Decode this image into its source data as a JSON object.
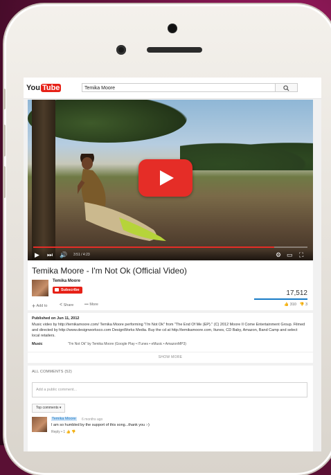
{
  "youtube": {
    "logo_you": "You",
    "logo_tube": "Tube",
    "search_query": "Temika Moore"
  },
  "player": {
    "time": "3:51 / 4:23",
    "progress_fraction": 0.88
  },
  "video": {
    "title": "Temika Moore - I'm Not Ok (Official Video)",
    "channel": "Temika Moore",
    "subscribe_label": "Subscribe",
    "views": "17,512",
    "add_to_label": "Add to",
    "share_label": "Share",
    "more_label": "More",
    "likes": "310",
    "dislikes": "3"
  },
  "description": {
    "published": "Published on Jun 11, 2012",
    "text": "Music video by http://temikamoore.com/ Temika Moore performing \"I'm Not Ok\" from \"The End Of Me (EP).\" (C) 2012 Moore II Come Entertainment Group. Filmed and directed by http://www.designworksco.com DesignWorks Media. Buy the cd at http://temikamoore.com, Itunes, CD Baby, Amazon, Band Camp and select local retailers.",
    "music_label": "Music",
    "music_value": "\"I'm Not Ok\" by Temika Moore (Google Play • iTunes • eMusic • AmazonMP3)",
    "show_more": "SHOW MORE"
  },
  "comments": {
    "header": "ALL COMMENTS (52)",
    "input_placeholder": "Add a public comment...",
    "sort_label": "Top comments",
    "items": [
      {
        "author": "Temika Moore",
        "age": "6 months ago",
        "text": "I am so humbled by the support of this song...thank you :-)",
        "reply_label": "Reply",
        "likes": "1"
      }
    ]
  },
  "colors": {
    "youtube_red": "#e52d27",
    "link_blue": "#167ac6"
  }
}
